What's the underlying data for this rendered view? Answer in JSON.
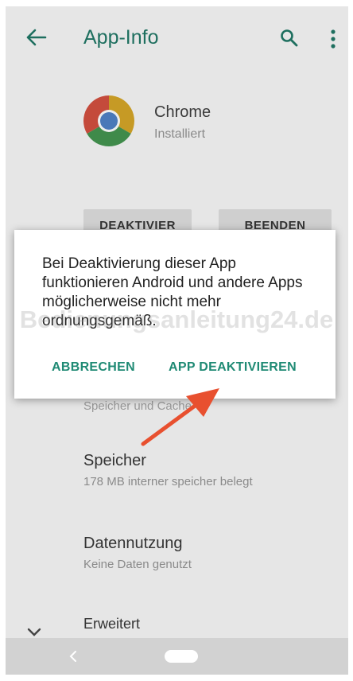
{
  "header": {
    "title": "App-Info",
    "back_icon": "arrow-back-icon",
    "search_icon": "search-icon",
    "more_icon": "more-vert-icon"
  },
  "app": {
    "name": "Chrome",
    "status": "Installiert",
    "icon": "chrome-logo"
  },
  "actions": {
    "deactivate_label": "DEAKTIVIER",
    "stop_label": "BEENDEN"
  },
  "dialog": {
    "message": "Bei Deaktivierung dieser App funktionieren Android und andere Apps möglicherweise nicht mehr ordnungsgemäß.",
    "cancel_label": "ABBRECHEN",
    "confirm_label": "APP DEAKTIVIEREN"
  },
  "list": {
    "partial_item": "Speicher und Cache",
    "items": [
      {
        "title": "Speicher",
        "subtitle": "178 MB interner speicher belegt"
      },
      {
        "title": "Datennutzung",
        "subtitle": "Keine Daten genutzt"
      },
      {
        "title": "Erweitert",
        "subtitle": ""
      }
    ]
  },
  "watermark": "Bedienungsanleitung24.de",
  "colors": {
    "accent": "#1f8a74",
    "title": "#1e6f5f",
    "scrim_background": "#e6e6e6",
    "arrow": "#e8502f"
  }
}
